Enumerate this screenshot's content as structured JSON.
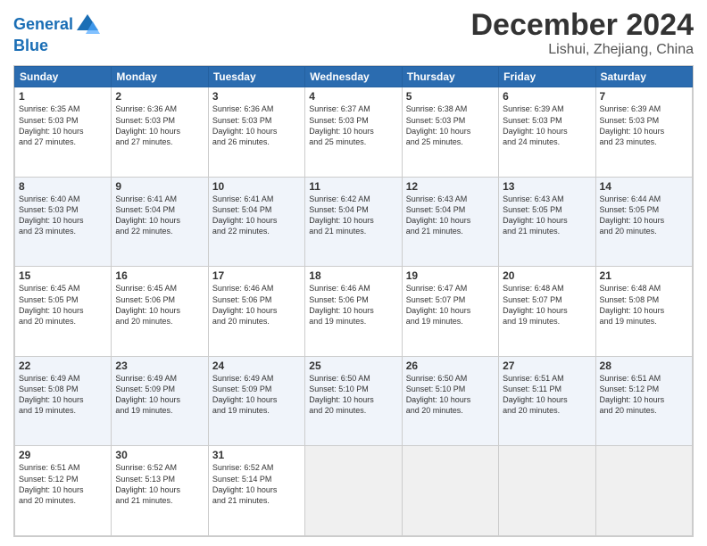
{
  "logo": {
    "line1": "General",
    "line2": "Blue"
  },
  "title": "December 2024",
  "location": "Lishui, Zhejiang, China",
  "days_of_week": [
    "Sunday",
    "Monday",
    "Tuesday",
    "Wednesday",
    "Thursday",
    "Friday",
    "Saturday"
  ],
  "weeks": [
    [
      {
        "num": "1",
        "info": "Sunrise: 6:35 AM\nSunset: 5:03 PM\nDaylight: 10 hours\nand 27 minutes."
      },
      {
        "num": "2",
        "info": "Sunrise: 6:36 AM\nSunset: 5:03 PM\nDaylight: 10 hours\nand 27 minutes."
      },
      {
        "num": "3",
        "info": "Sunrise: 6:36 AM\nSunset: 5:03 PM\nDaylight: 10 hours\nand 26 minutes."
      },
      {
        "num": "4",
        "info": "Sunrise: 6:37 AM\nSunset: 5:03 PM\nDaylight: 10 hours\nand 25 minutes."
      },
      {
        "num": "5",
        "info": "Sunrise: 6:38 AM\nSunset: 5:03 PM\nDaylight: 10 hours\nand 25 minutes."
      },
      {
        "num": "6",
        "info": "Sunrise: 6:39 AM\nSunset: 5:03 PM\nDaylight: 10 hours\nand 24 minutes."
      },
      {
        "num": "7",
        "info": "Sunrise: 6:39 AM\nSunset: 5:03 PM\nDaylight: 10 hours\nand 23 minutes."
      }
    ],
    [
      {
        "num": "8",
        "info": "Sunrise: 6:40 AM\nSunset: 5:03 PM\nDaylight: 10 hours\nand 23 minutes."
      },
      {
        "num": "9",
        "info": "Sunrise: 6:41 AM\nSunset: 5:04 PM\nDaylight: 10 hours\nand 22 minutes."
      },
      {
        "num": "10",
        "info": "Sunrise: 6:41 AM\nSunset: 5:04 PM\nDaylight: 10 hours\nand 22 minutes."
      },
      {
        "num": "11",
        "info": "Sunrise: 6:42 AM\nSunset: 5:04 PM\nDaylight: 10 hours\nand 21 minutes."
      },
      {
        "num": "12",
        "info": "Sunrise: 6:43 AM\nSunset: 5:04 PM\nDaylight: 10 hours\nand 21 minutes."
      },
      {
        "num": "13",
        "info": "Sunrise: 6:43 AM\nSunset: 5:05 PM\nDaylight: 10 hours\nand 21 minutes."
      },
      {
        "num": "14",
        "info": "Sunrise: 6:44 AM\nSunset: 5:05 PM\nDaylight: 10 hours\nand 20 minutes."
      }
    ],
    [
      {
        "num": "15",
        "info": "Sunrise: 6:45 AM\nSunset: 5:05 PM\nDaylight: 10 hours\nand 20 minutes."
      },
      {
        "num": "16",
        "info": "Sunrise: 6:45 AM\nSunset: 5:06 PM\nDaylight: 10 hours\nand 20 minutes."
      },
      {
        "num": "17",
        "info": "Sunrise: 6:46 AM\nSunset: 5:06 PM\nDaylight: 10 hours\nand 20 minutes."
      },
      {
        "num": "18",
        "info": "Sunrise: 6:46 AM\nSunset: 5:06 PM\nDaylight: 10 hours\nand 19 minutes."
      },
      {
        "num": "19",
        "info": "Sunrise: 6:47 AM\nSunset: 5:07 PM\nDaylight: 10 hours\nand 19 minutes."
      },
      {
        "num": "20",
        "info": "Sunrise: 6:48 AM\nSunset: 5:07 PM\nDaylight: 10 hours\nand 19 minutes."
      },
      {
        "num": "21",
        "info": "Sunrise: 6:48 AM\nSunset: 5:08 PM\nDaylight: 10 hours\nand 19 minutes."
      }
    ],
    [
      {
        "num": "22",
        "info": "Sunrise: 6:49 AM\nSunset: 5:08 PM\nDaylight: 10 hours\nand 19 minutes."
      },
      {
        "num": "23",
        "info": "Sunrise: 6:49 AM\nSunset: 5:09 PM\nDaylight: 10 hours\nand 19 minutes."
      },
      {
        "num": "24",
        "info": "Sunrise: 6:49 AM\nSunset: 5:09 PM\nDaylight: 10 hours\nand 19 minutes."
      },
      {
        "num": "25",
        "info": "Sunrise: 6:50 AM\nSunset: 5:10 PM\nDaylight: 10 hours\nand 20 minutes."
      },
      {
        "num": "26",
        "info": "Sunrise: 6:50 AM\nSunset: 5:10 PM\nDaylight: 10 hours\nand 20 minutes."
      },
      {
        "num": "27",
        "info": "Sunrise: 6:51 AM\nSunset: 5:11 PM\nDaylight: 10 hours\nand 20 minutes."
      },
      {
        "num": "28",
        "info": "Sunrise: 6:51 AM\nSunset: 5:12 PM\nDaylight: 10 hours\nand 20 minutes."
      }
    ],
    [
      {
        "num": "29",
        "info": "Sunrise: 6:51 AM\nSunset: 5:12 PM\nDaylight: 10 hours\nand 20 minutes."
      },
      {
        "num": "30",
        "info": "Sunrise: 6:52 AM\nSunset: 5:13 PM\nDaylight: 10 hours\nand 21 minutes."
      },
      {
        "num": "31",
        "info": "Sunrise: 6:52 AM\nSunset: 5:14 PM\nDaylight: 10 hours\nand 21 minutes."
      },
      null,
      null,
      null,
      null
    ]
  ]
}
